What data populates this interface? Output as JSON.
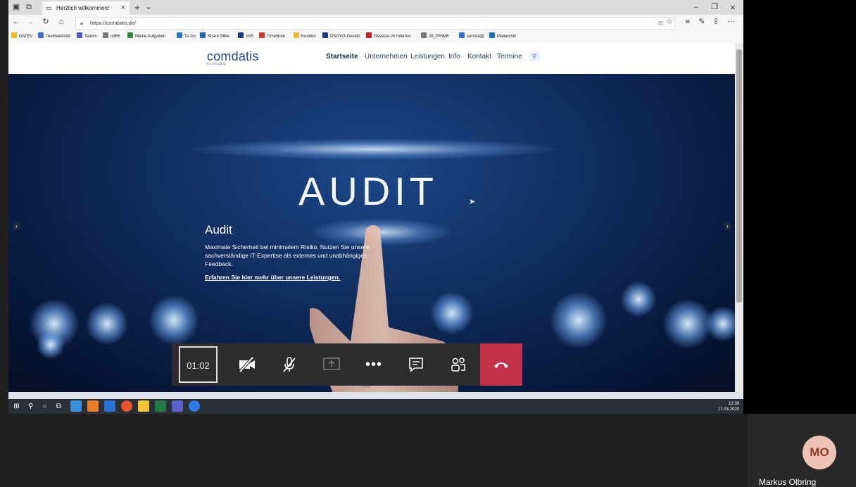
{
  "browser": {
    "tab_title": "Herzlich willkommen!",
    "tab_close": "×",
    "new_tab": "+",
    "tab_menu": "⌄",
    "url": "https://comdatis.de/",
    "window_minimize": "–",
    "window_restore": "❐",
    "window_close": "×",
    "favorites": [
      {
        "label": "DATEV",
        "color": "#f2b824"
      },
      {
        "label": "Teamwebsite",
        "color": "#3b6fc7"
      },
      {
        "label": "Teams",
        "color": "#5059c9"
      },
      {
        "label": "o365",
        "color": "#777777"
      },
      {
        "label": "Meine Aufgaben",
        "color": "#2e8b3e"
      },
      {
        "label": "To-Do",
        "color": "#2a72d6"
      },
      {
        "label": "Share Silke",
        "color": "#1c62c4"
      },
      {
        "label": "VdS",
        "color": "#1c3a8a"
      },
      {
        "label": "TimeNote",
        "color": "#d33a2c"
      },
      {
        "label": "Kunden",
        "color": "#f2b824"
      },
      {
        "label": "DSGVO-Gesetz",
        "color": "#1c3a8a"
      },
      {
        "label": "Gesetze im Internet",
        "color": "#c0201e"
      },
      {
        "label": "28_PRIME",
        "color": "#777777"
      },
      {
        "label": "service@",
        "color": "#3b6fc7"
      },
      {
        "label": "Mailarchiv",
        "color": "#1d6fc4"
      }
    ]
  },
  "site": {
    "logo": "comdatis",
    "logo_sub": "it-consulting",
    "nav": [
      "Startseite",
      "Unternehmen",
      "Leistungen",
      "Info",
      "Kontakt",
      "Termine"
    ],
    "hero_big_text": "AUDIT",
    "slide_title": "Audit",
    "slide_text": "Maximale Sicherheit bei minimalem Risiko. Nutzen Sie unsere sachverständige IT-Expertise als externes und unabhängiges Feedback.",
    "slide_link": "Erfahren Sie hier mehr über unsere Leistungen."
  },
  "taskbar": {
    "time": "12:39",
    "date": "17.03.2020"
  },
  "call": {
    "timer": "01:02",
    "hangup_color": "#c4314b"
  },
  "participant": {
    "initials": "MO",
    "name": "Markus Olbring"
  }
}
